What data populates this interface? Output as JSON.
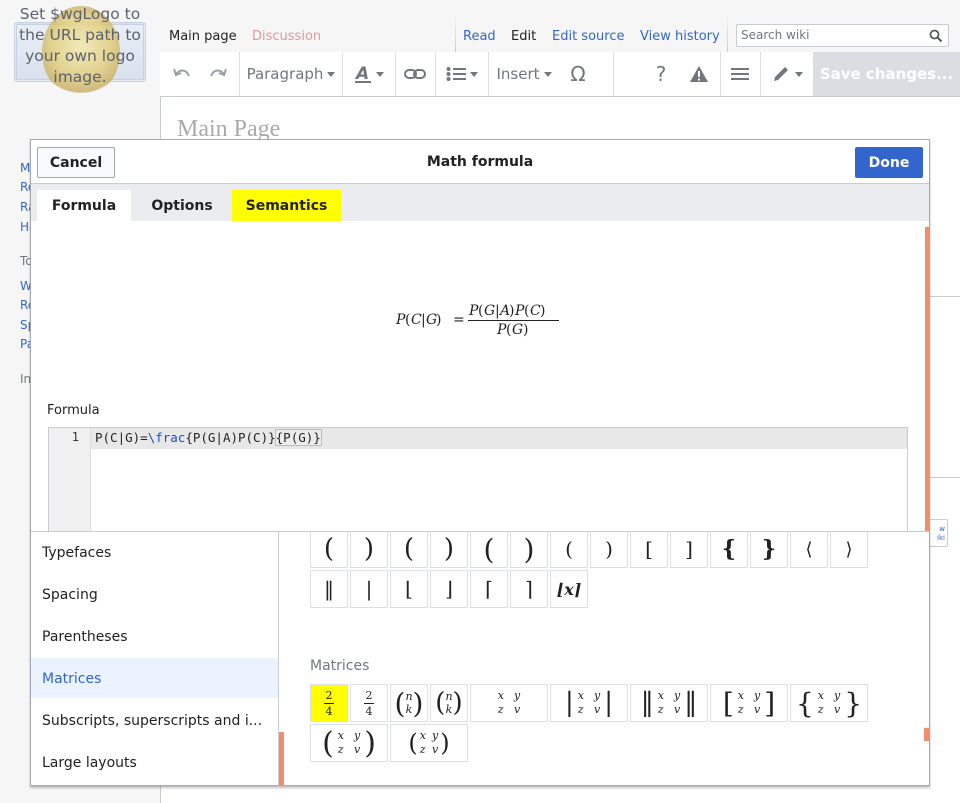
{
  "logo": {
    "text": "Set $wgLogo to the URL path to your own logo image."
  },
  "sidebar": {
    "links": [
      "M",
      "Re",
      "Ra",
      "He"
    ],
    "tools_heading": "To",
    "tools_links": [
      "W",
      "Re",
      "Sp",
      "Pa"
    ],
    "in_heading": "In"
  },
  "page_tabs": {
    "main_page": "Main page",
    "discussion": "Discussion",
    "read": "Read",
    "edit": "Edit",
    "edit_source": "Edit source",
    "view_history": "View history"
  },
  "search": {
    "placeholder": "Search wiki",
    "icon": "search-icon"
  },
  "toolbar": {
    "format": "Paragraph",
    "insert": "Insert",
    "save_label": "Save changes..."
  },
  "page_title": "Main Page",
  "dialog": {
    "title": "Math formula",
    "cancel_label": "Cancel",
    "done_label": "Done",
    "tabs": [
      {
        "label": "Formula",
        "active": true
      },
      {
        "label": "Options",
        "active": false
      },
      {
        "label": "Semantics",
        "highlighted": true
      }
    ],
    "preview_formula": "P(C|G) = P(G|A)P(C) / P(G)",
    "formula_label": "Formula",
    "editor": {
      "line_number": "1",
      "code_prefix": "P(C|G)=",
      "code_keyword": "\\frac",
      "code_suffix": "{P(G|A)P(C)}",
      "code_tail": "{P(G)}"
    },
    "categories": [
      {
        "label": "Typefaces",
        "active": false
      },
      {
        "label": "Spacing",
        "active": false
      },
      {
        "label": "Parentheses",
        "active": false
      },
      {
        "label": "Matrices",
        "active": true
      },
      {
        "label": "Subscripts, superscripts and i...",
        "active": false
      },
      {
        "label": "Large layouts",
        "active": false
      }
    ],
    "palette": {
      "parentheses_row1": [
        "(",
        ")",
        "(",
        ")",
        "(",
        ")",
        "(",
        ")",
        "[",
        "]",
        "{",
        "}",
        "⟨",
        "⟩"
      ],
      "parentheses_row2": [
        "‖",
        "|",
        "⌊",
        "⌋",
        "⌈",
        "⌉",
        "⌊x⌉"
      ],
      "matrices_title": "Matrices",
      "fraction": {
        "numerator": "2",
        "denominator": "4"
      },
      "binomial": {
        "top": "n",
        "bottom": "k"
      },
      "matrix_entries": [
        "x",
        "y",
        "z",
        "v"
      ],
      "highlight_color": "#ffff00"
    }
  },
  "colors": {
    "accent": "#3366cc",
    "scroll": "#f08e6e",
    "highlight": "#ffff00"
  }
}
